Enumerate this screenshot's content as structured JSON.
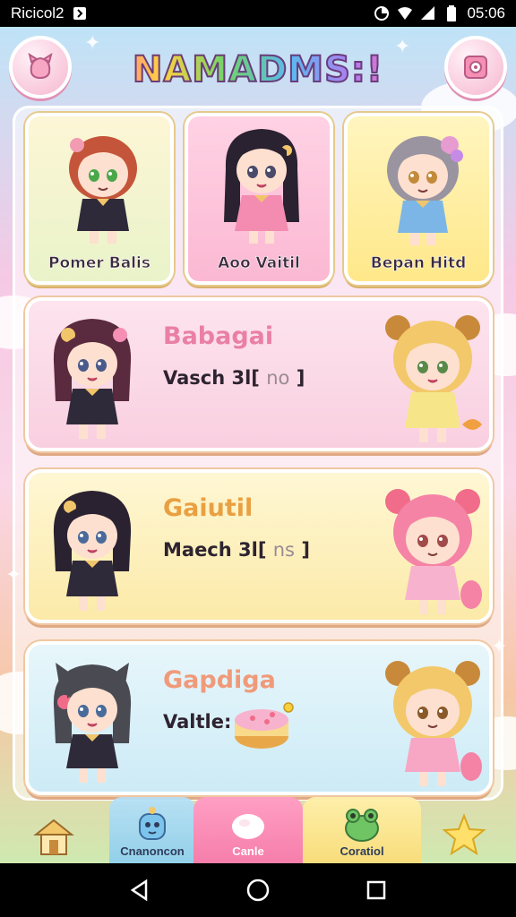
{
  "status_bar": {
    "carrier": "Ricicol2",
    "time": "05:06"
  },
  "header": {
    "title": "NAMADMS:!",
    "left_icon": "pet-paw-icon",
    "right_icon": "settings-icon"
  },
  "characters": [
    {
      "label": "Pomer Balis",
      "hair": "#c4553a",
      "eyes": "#4aa84a",
      "outfit": "#2f2a3a"
    },
    {
      "label": "Aoo Vaitil",
      "hair": "#2a2230",
      "eyes": "#4a4a6a",
      "outfit": "#f48bb0"
    },
    {
      "label": "Bepan Hitd",
      "hair": "#9a94a0",
      "eyes": "#c28a3a",
      "outfit": "#7cb6e6"
    }
  ],
  "list": [
    {
      "name": "Babagai",
      "stat_prefix": "Vasch 3l[",
      "stat_hint": "no",
      "stat_suffix": "]"
    },
    {
      "name": "Gaiutil",
      "stat_prefix": "Maech 3l[",
      "stat_hint": "ns",
      "stat_suffix": "]"
    },
    {
      "name": "Gapdiga",
      "stat_prefix": "Valtle:",
      "stat_hint": "",
      "stat_suffix": ""
    }
  ],
  "bottom_nav": {
    "home_icon": "house-icon",
    "companion": "Cnanoncon",
    "cards": "Canle",
    "cottage": "Coratiol",
    "star_icon": "star-icon"
  },
  "colors": {
    "accent": "#f57eaa",
    "title_stroke": "#6a3d7a"
  }
}
